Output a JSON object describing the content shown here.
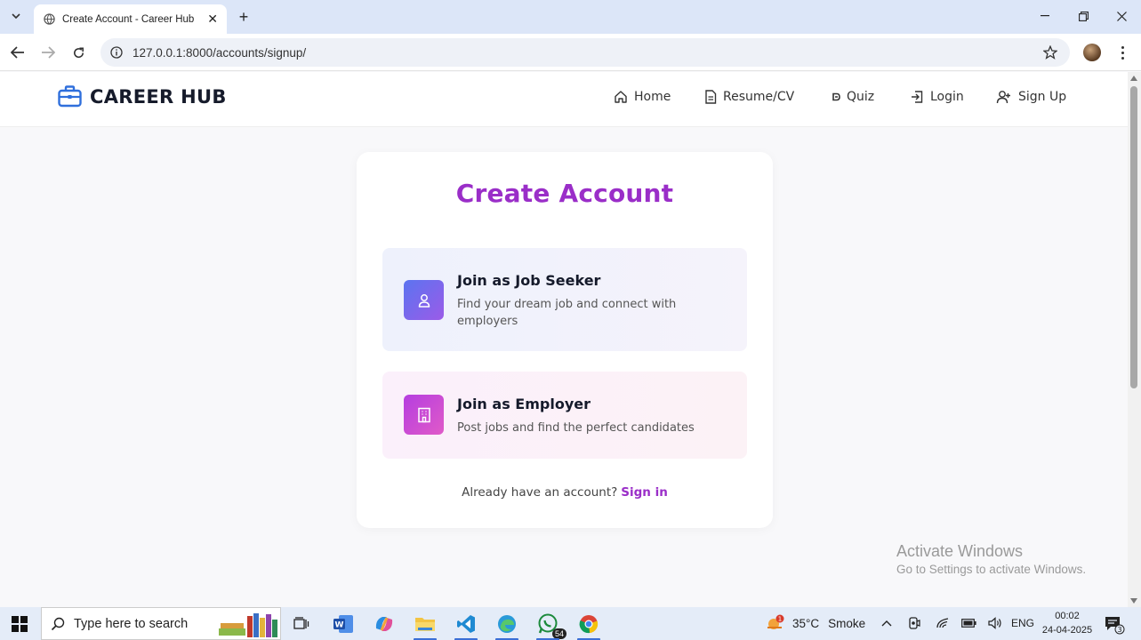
{
  "browser": {
    "tab_title": "Create Account - Career Hub",
    "url": "127.0.0.1:8000/accounts/signup/"
  },
  "site": {
    "brand": "CAREER HUB",
    "nav": [
      {
        "label": "Home",
        "icon": "home-icon"
      },
      {
        "label": "Resume/CV",
        "icon": "document-icon"
      },
      {
        "label": "Quiz",
        "icon": "quiz-icon"
      },
      {
        "label": "Login",
        "icon": "login-icon"
      },
      {
        "label": "Sign Up",
        "icon": "user-plus-icon"
      }
    ]
  },
  "signup": {
    "title": "Create Account",
    "options": [
      {
        "title": "Join as Job Seeker",
        "description": "Find your dream job and connect with employers",
        "icon": "user-icon"
      },
      {
        "title": "Join as Employer",
        "description": "Post jobs and find the perfect candidates",
        "icon": "building-icon"
      }
    ],
    "signin_prompt": "Already have an account?",
    "signin_link": "Sign in"
  },
  "watermark": {
    "line1": "Activate Windows",
    "line2": "Go to Settings to activate Windows."
  },
  "taskbar": {
    "search_placeholder": "Type here to search",
    "whatsapp_badge": "54",
    "weather_alert": "1",
    "temperature": "35°C",
    "condition": "Smoke",
    "language": "ENG",
    "time": "00:02",
    "date": "24-04-2025",
    "notifications": "3"
  },
  "colors": {
    "accent": "#9a2ec8",
    "brand_icon": "#2f6fdc",
    "seeker_gradient": [
      "#5b74f0",
      "#9b5be8"
    ],
    "employer_gradient": [
      "#b53ee0",
      "#e05ac8"
    ]
  }
}
